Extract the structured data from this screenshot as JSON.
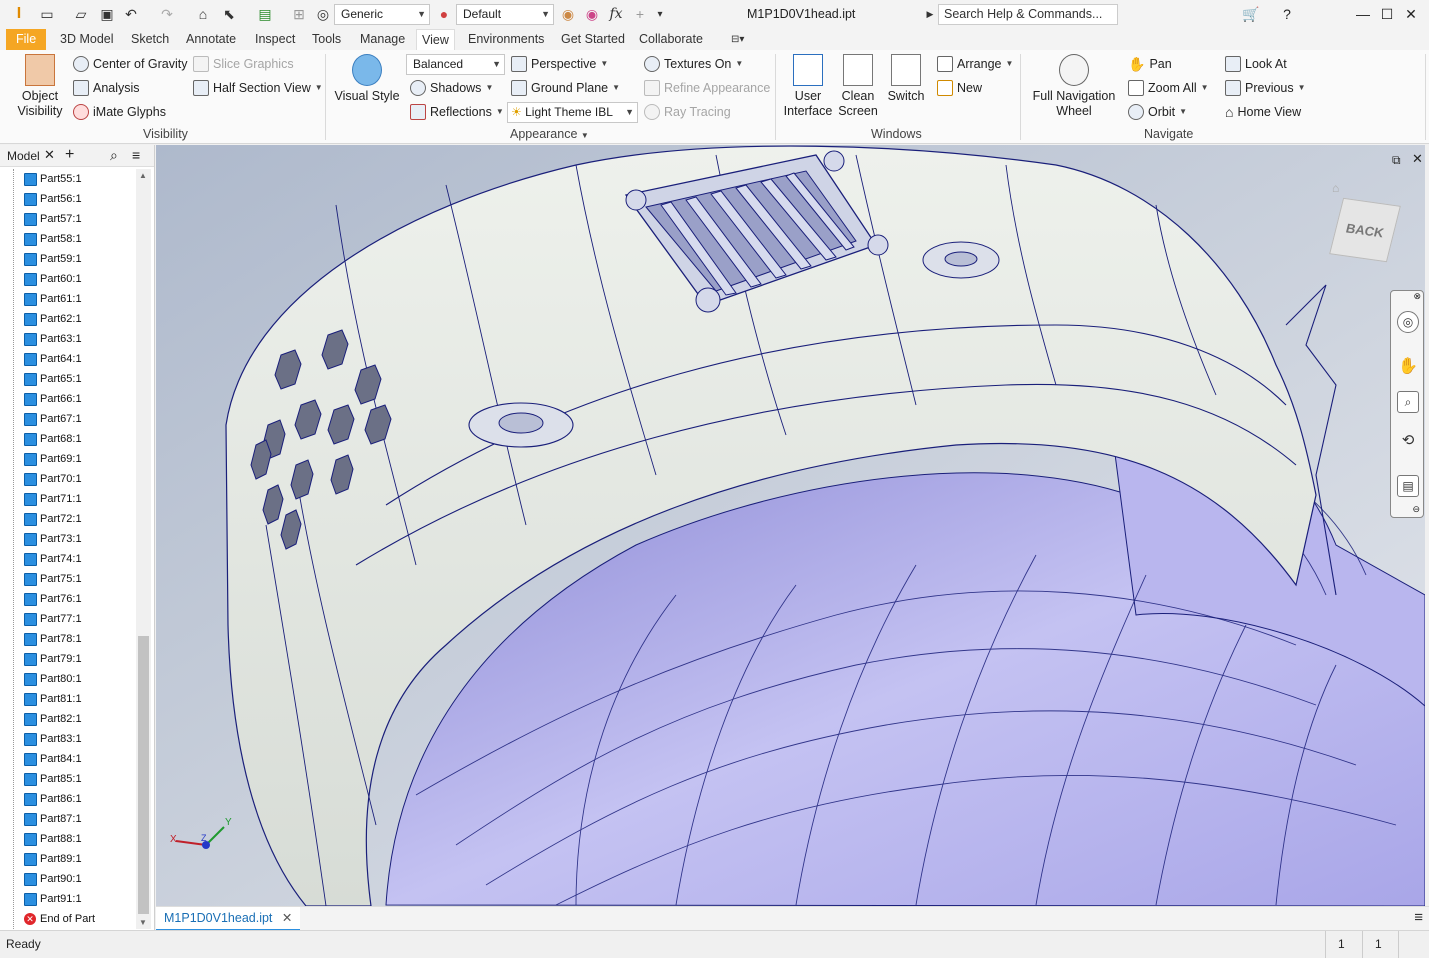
{
  "titlebar": {
    "visual_style": "Generic",
    "appearance": "Default",
    "doc_title": "M1P1D0V1head.ipt",
    "search_placeholder": "Search Help & Commands...",
    "fx": "fx"
  },
  "tabs": [
    "File",
    "3D Model",
    "Sketch",
    "Annotate",
    "Inspect",
    "Tools",
    "Manage",
    "View",
    "Environments",
    "Get Started",
    "Collaborate"
  ],
  "active_tab": "View",
  "ribbon": {
    "visibility": {
      "object_visibility": "Object Visibility",
      "center_of_gravity": "Center of Gravity",
      "slice_graphics": "Slice Graphics",
      "analysis": "Analysis",
      "half_section_view": "Half Section View",
      "imate_glyphs": "iMate Glyphs",
      "group": "Visibility"
    },
    "appearance": {
      "visual_style": "Visual Style",
      "balanced": "Balanced",
      "perspective": "Perspective",
      "textures_on": "Textures On",
      "shadows": "Shadows",
      "ground_plane": "Ground Plane",
      "refine_appearance": "Refine Appearance",
      "reflections": "Reflections",
      "light_theme": "Light Theme IBL",
      "ray_tracing": "Ray Tracing",
      "group": "Appearance"
    },
    "windows": {
      "user_interface": "User Interface",
      "clean_screen": "Clean Screen",
      "switch": "Switch",
      "arrange": "Arrange",
      "new": "New",
      "group": "Windows"
    },
    "navigate": {
      "full_nav_wheel": "Full Navigation Wheel",
      "pan": "Pan",
      "look_at": "Look At",
      "zoom_all": "Zoom All",
      "previous": "Previous",
      "orbit": "Orbit",
      "home_view": "Home View",
      "group": "Navigate"
    }
  },
  "browser": {
    "title": "Model",
    "items": [
      "Part55:1",
      "Part56:1",
      "Part57:1",
      "Part58:1",
      "Part59:1",
      "Part60:1",
      "Part61:1",
      "Part62:1",
      "Part63:1",
      "Part64:1",
      "Part65:1",
      "Part66:1",
      "Part67:1",
      "Part68:1",
      "Part69:1",
      "Part70:1",
      "Part71:1",
      "Part72:1",
      "Part73:1",
      "Part74:1",
      "Part75:1",
      "Part76:1",
      "Part77:1",
      "Part78:1",
      "Part79:1",
      "Part80:1",
      "Part81:1",
      "Part82:1",
      "Part83:1",
      "Part84:1",
      "Part85:1",
      "Part86:1",
      "Part87:1",
      "Part88:1",
      "Part89:1",
      "Part90:1",
      "Part91:1"
    ],
    "end_of_part": "End of Part"
  },
  "viewcube": {
    "face": "BACK"
  },
  "triad": {
    "x": "X",
    "y": "Y",
    "z": "Z"
  },
  "doc_tab": "M1P1D0V1head.ipt",
  "status": {
    "text": "Ready",
    "count1": "1",
    "count2": "1"
  },
  "colors": {
    "file_tab": "#f5a623",
    "accent": "#2b8fe0",
    "mesh_edge": "#1a1f7a",
    "body_white": "#e7ebe6",
    "body_lavender": "#b3b1ea"
  }
}
